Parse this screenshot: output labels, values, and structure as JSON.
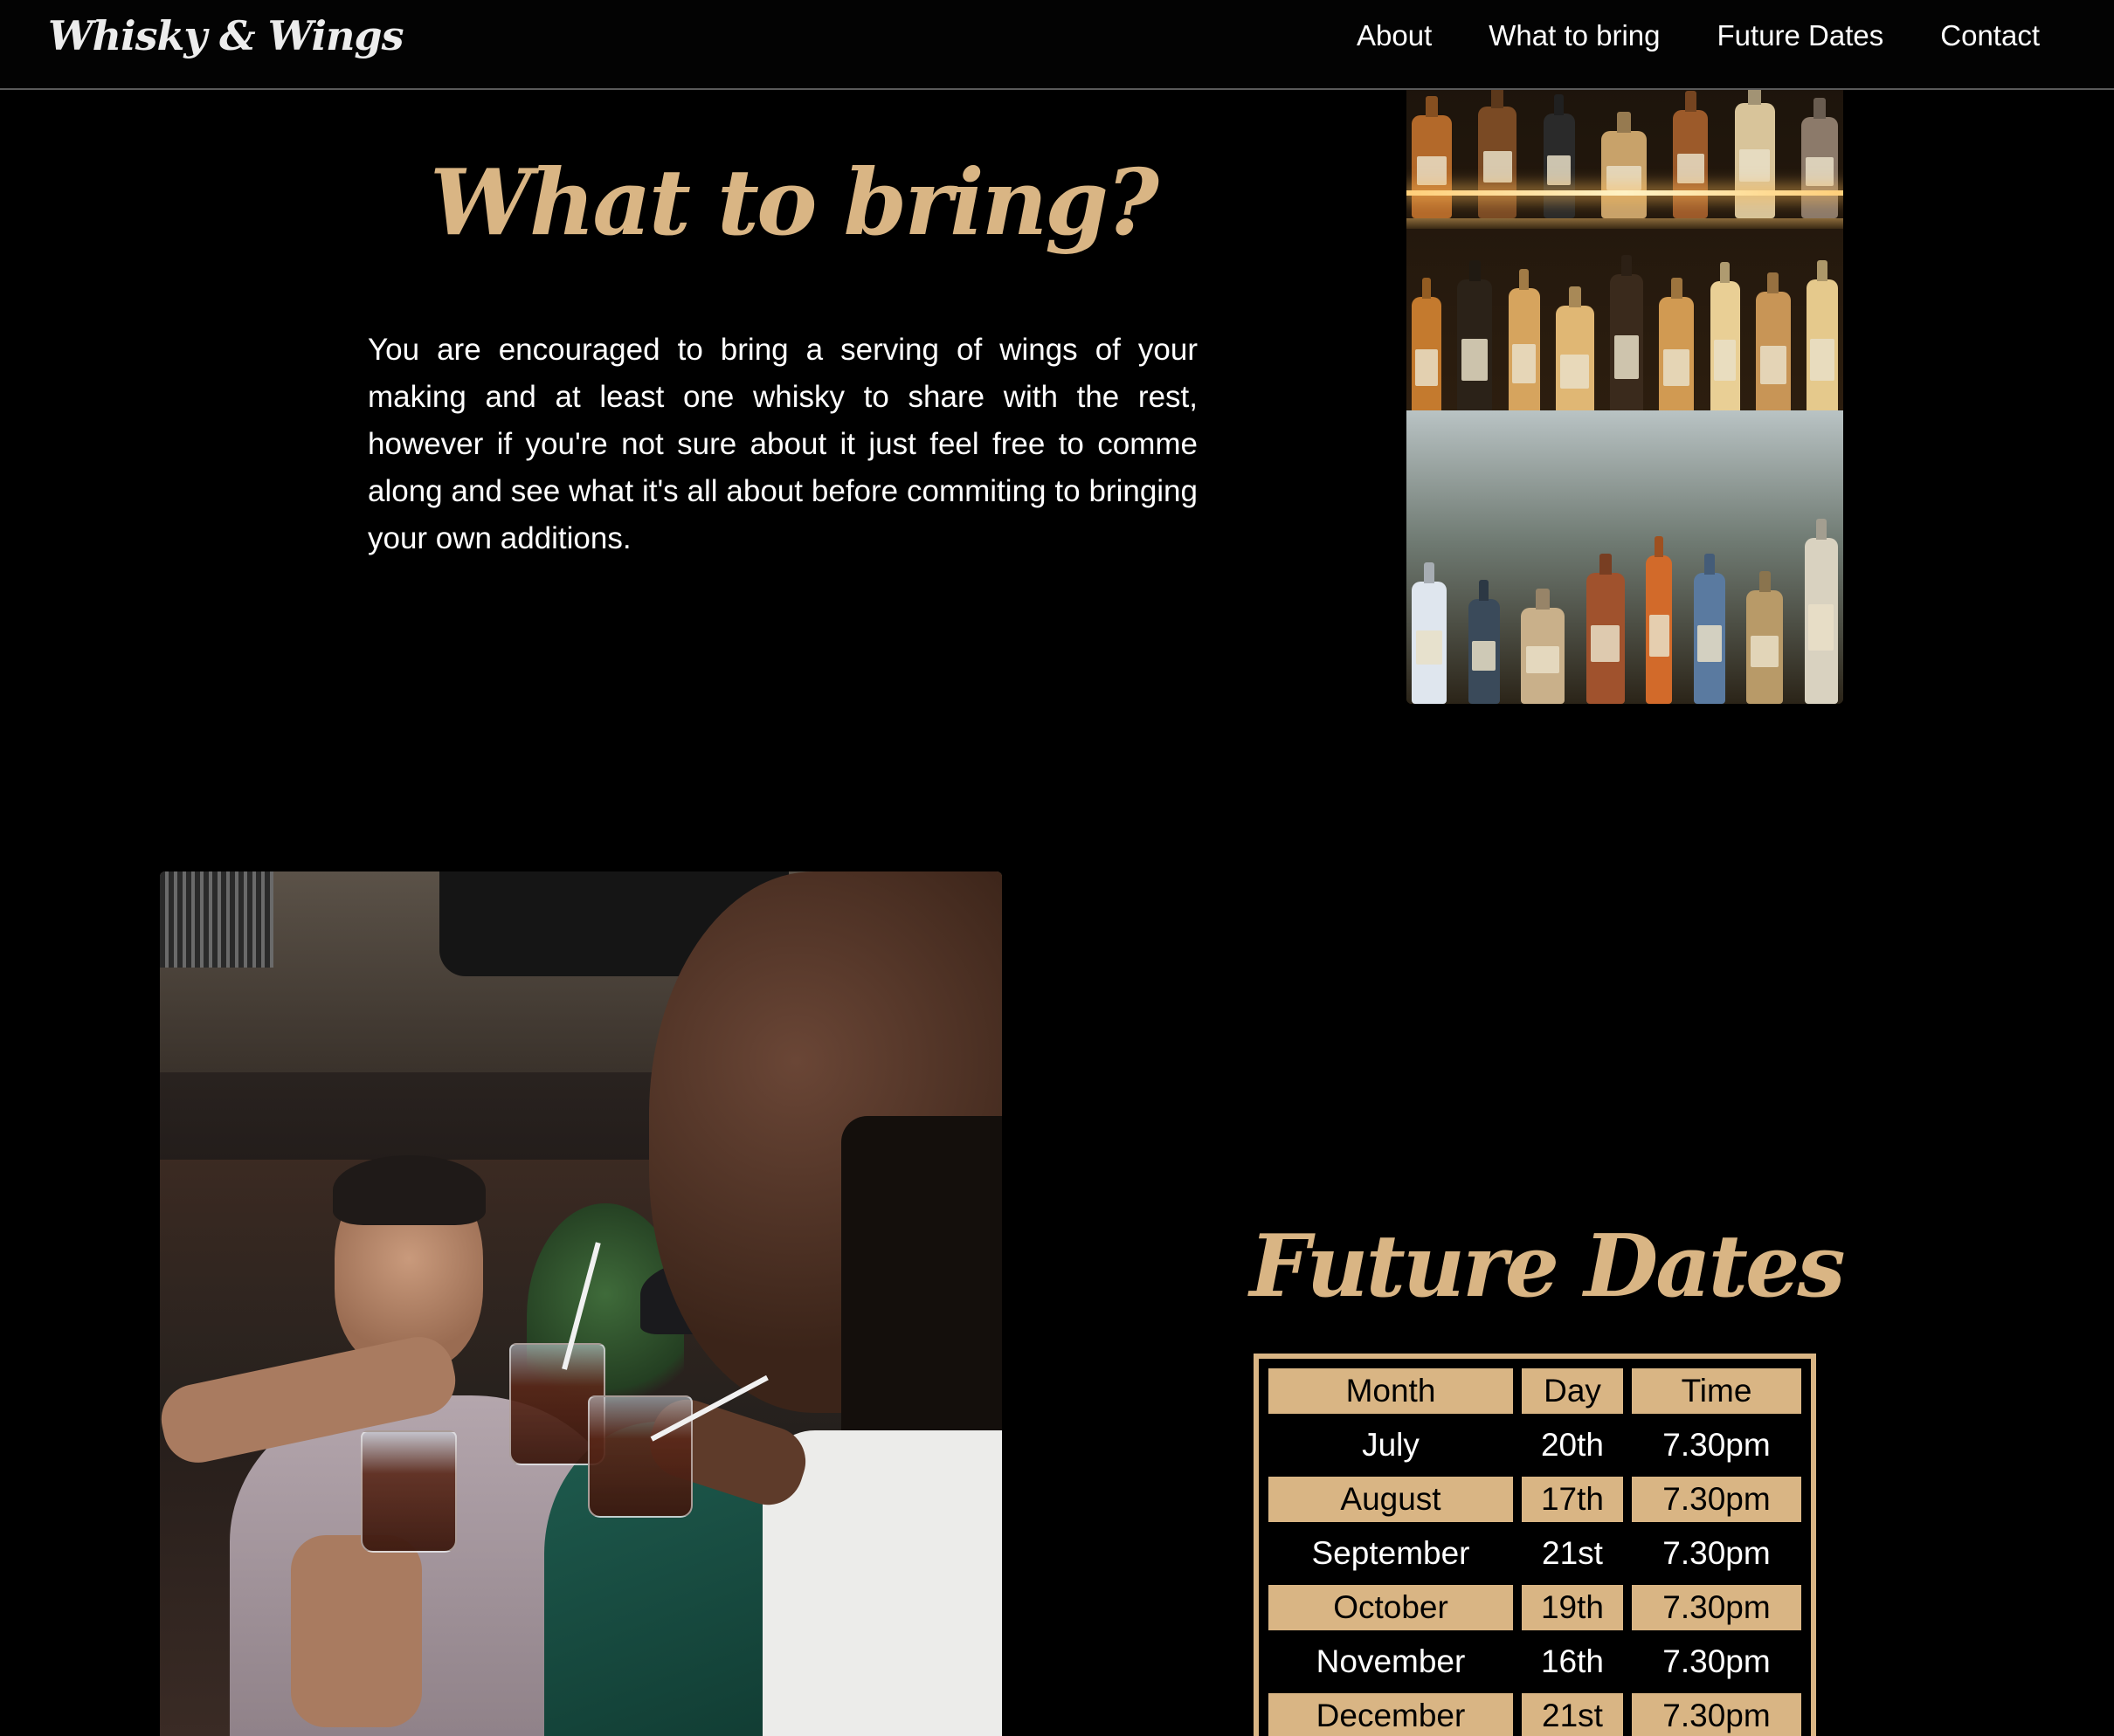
{
  "header": {
    "brand": "Whisky & Wings",
    "nav": [
      "About",
      "What to bring",
      "Future Dates",
      "Contact"
    ]
  },
  "bring": {
    "title": "What to bring?",
    "text": "You are encouraged to bring a serving of wings of your making and at least one whisky to share with the rest, however if you're not sure about it just feel free to comme along and see what it's all about before commiting to bringing your own additions."
  },
  "dates": {
    "title": "Future Dates",
    "columns": [
      "Month",
      "Day",
      "Time"
    ],
    "rows": [
      [
        "July",
        "20th",
        "7.30pm"
      ],
      [
        "August",
        "17th",
        "7.30pm"
      ],
      [
        "September",
        "21st",
        "7.30pm"
      ],
      [
        "October",
        "19th",
        "7.30pm"
      ],
      [
        "November",
        "16th",
        "7.30pm"
      ],
      [
        "December",
        "21st",
        "7.30pm"
      ]
    ]
  },
  "colors": {
    "accent": "#d9b584",
    "background": "#000000",
    "text": "#ffffff"
  }
}
